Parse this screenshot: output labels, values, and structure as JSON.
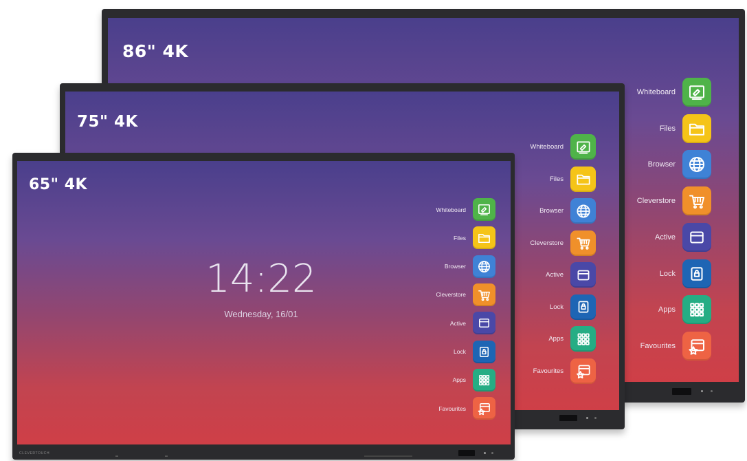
{
  "displays": [
    {
      "size_label": "86\" 4K"
    },
    {
      "size_label": "75\" 4K"
    },
    {
      "size_label": "65\" 4K"
    }
  ],
  "dock_items": [
    {
      "label": "Whiteboard",
      "icon": "whiteboard-icon",
      "color": "#4fb349"
    },
    {
      "label": "Files",
      "icon": "folder-icon",
      "color": "#f5c418"
    },
    {
      "label": "Browser",
      "icon": "globe-icon",
      "color": "#3f82d6"
    },
    {
      "label": "Cleverstore",
      "icon": "cart-icon",
      "color": "#f0902a"
    },
    {
      "label": "Active",
      "icon": "window-icon",
      "color": "#4a48a7"
    },
    {
      "label": "Lock",
      "icon": "lock-icon",
      "color": "#1e65b4"
    },
    {
      "label": "Apps",
      "icon": "grid-icon",
      "color": "#25ad84"
    },
    {
      "label": "Favourites",
      "icon": "star-window-icon",
      "color": "#ee6344"
    }
  ],
  "clock": {
    "time": "14:22",
    "date": "Wednesday, 16/01"
  },
  "brand": "CLEVERTOUCH"
}
